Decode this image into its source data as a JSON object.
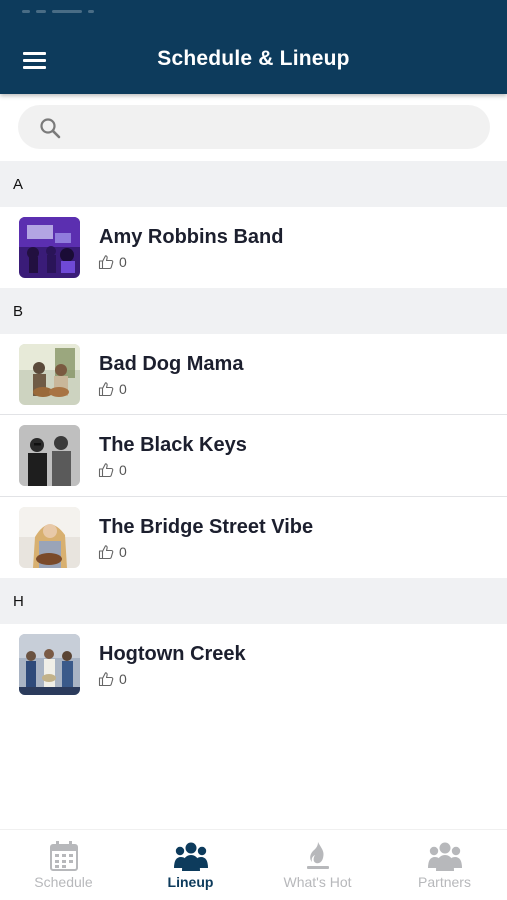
{
  "header": {
    "title": "Schedule & Lineup",
    "menu_icon": "hamburger-menu-icon"
  },
  "search": {
    "placeholder": "",
    "value": ""
  },
  "sections": [
    {
      "letter": "A",
      "items": [
        {
          "name": "Amy Robbins Band",
          "likes": "0"
        }
      ]
    },
    {
      "letter": "B",
      "items": [
        {
          "name": "Bad Dog Mama",
          "likes": "0"
        },
        {
          "name": "The Black Keys",
          "likes": "0"
        },
        {
          "name": "The Bridge Street Vibe",
          "likes": "0"
        }
      ]
    },
    {
      "letter": "H",
      "items": [
        {
          "name": "Hogtown Creek",
          "likes": "0"
        }
      ]
    }
  ],
  "tabs": [
    {
      "label": "Schedule",
      "icon": "calendar-icon",
      "active": false
    },
    {
      "label": "Lineup",
      "icon": "people-group-icon",
      "active": true
    },
    {
      "label": "What's Hot",
      "icon": "flame-icon",
      "active": false
    },
    {
      "label": "Partners",
      "icon": "people-group-icon",
      "active": false
    }
  ],
  "colors": {
    "header_bg": "#0d3b5c",
    "accent": "#0d3b5c",
    "inactive_tab": "#b7b8bb",
    "section_bg": "#f0f1f3"
  }
}
